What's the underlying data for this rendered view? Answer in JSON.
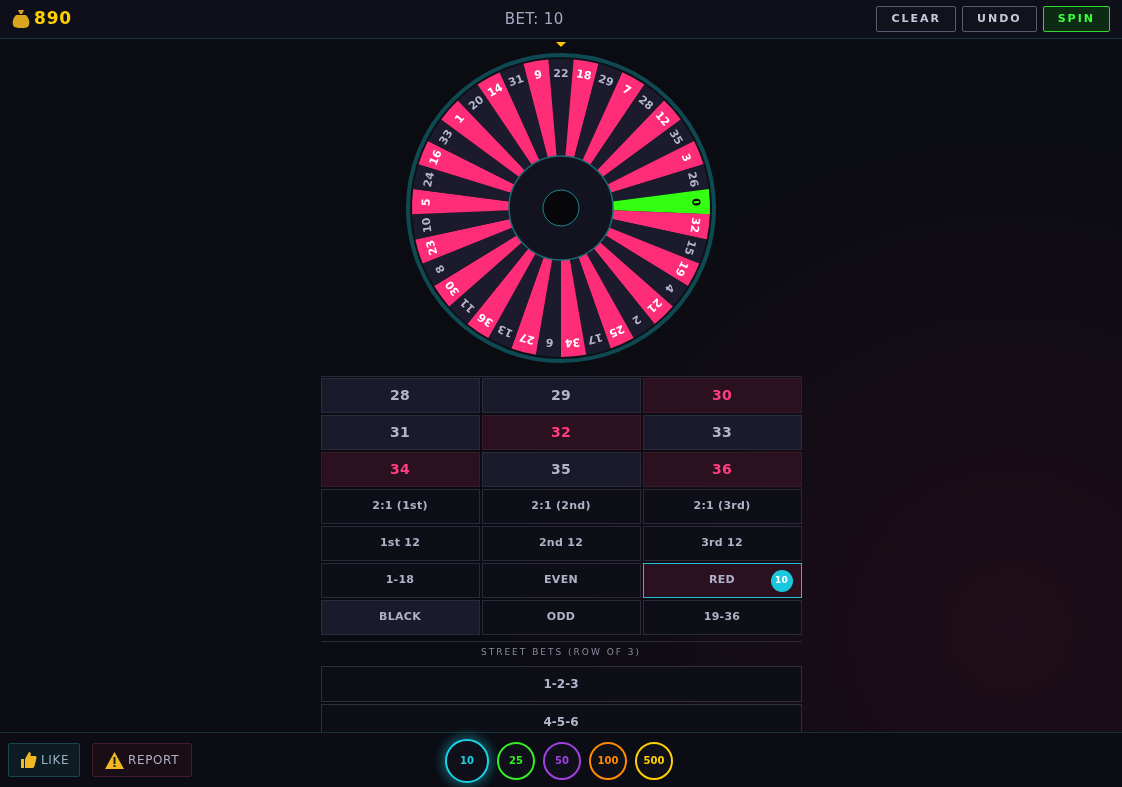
{
  "header": {
    "balance": "890",
    "bet": "BET: 10",
    "buttons": [
      {
        "label": "CLEAR",
        "kind": "plain"
      },
      {
        "label": "UNDO",
        "kind": "plain"
      },
      {
        "label": "SPIN",
        "kind": "primary"
      }
    ]
  },
  "wheel": {
    "pockets": [
      {
        "number": "22",
        "color": "#1c1b2e"
      },
      {
        "number": "18",
        "color": "#ff2d78"
      },
      {
        "number": "29",
        "color": "#1c1b2e"
      },
      {
        "number": "7",
        "color": "#ff2d78"
      },
      {
        "number": "28",
        "color": "#1c1b2e"
      },
      {
        "number": "12",
        "color": "#ff2d78"
      },
      {
        "number": "35",
        "color": "#1c1b2e"
      },
      {
        "number": "3",
        "color": "#ff2d78"
      },
      {
        "number": "26",
        "color": "#1c1b2e"
      },
      {
        "number": "0",
        "color": "#33ff11"
      },
      {
        "number": "32",
        "color": "#ff2d78"
      },
      {
        "number": "15",
        "color": "#1c1b2e"
      },
      {
        "number": "19",
        "color": "#ff2d78"
      },
      {
        "number": "4",
        "color": "#1c1b2e"
      },
      {
        "number": "21",
        "color": "#ff2d78"
      },
      {
        "number": "2",
        "color": "#1c1b2e"
      },
      {
        "number": "25",
        "color": "#ff2d78"
      },
      {
        "number": "17",
        "color": "#1c1b2e"
      },
      {
        "number": "34",
        "color": "#ff2d78"
      },
      {
        "number": "6",
        "color": "#1c1b2e"
      },
      {
        "number": "27",
        "color": "#ff2d78"
      },
      {
        "number": "13",
        "color": "#1c1b2e"
      },
      {
        "number": "36",
        "color": "#ff2d78"
      },
      {
        "number": "11",
        "color": "#1c1b2e"
      },
      {
        "number": "30",
        "color": "#ff2d78"
      },
      {
        "number": "8",
        "color": "#1c1b2e"
      },
      {
        "number": "23",
        "color": "#ff2d78"
      },
      {
        "number": "10",
        "color": "#1c1b2e"
      },
      {
        "number": "5",
        "color": "#ff2d78"
      },
      {
        "number": "24",
        "color": "#1c1b2e"
      },
      {
        "number": "16",
        "color": "#ff2d78"
      },
      {
        "number": "33",
        "color": "#1c1b2e"
      },
      {
        "number": "1",
        "color": "#ff2d78"
      },
      {
        "number": "20",
        "color": "#1c1b2e"
      },
      {
        "number": "14",
        "color": "#ff2d78"
      },
      {
        "number": "31",
        "color": "#1c1b2e"
      },
      {
        "number": "9",
        "color": "#ff2d78"
      }
    ]
  },
  "board": {
    "rows": [
      {
        "cells": [
          {
            "label": "28",
            "kind": "black",
            "selected": false
          },
          {
            "label": "29",
            "kind": "black",
            "selected": false
          },
          {
            "label": "30",
            "kind": "red",
            "selected": false
          }
        ]
      },
      {
        "cells": [
          {
            "label": "31",
            "kind": "black",
            "selected": false
          },
          {
            "label": "32",
            "kind": "red",
            "selected": false
          },
          {
            "label": "33",
            "kind": "black",
            "selected": false
          }
        ]
      },
      {
        "cells": [
          {
            "label": "34",
            "kind": "red",
            "selected": false
          },
          {
            "label": "35",
            "kind": "black",
            "selected": false
          },
          {
            "label": "36",
            "kind": "red",
            "selected": false
          }
        ]
      },
      {
        "cells": [
          {
            "label": "2:1 (1st)",
            "kind": "outside",
            "selected": false
          },
          {
            "label": "2:1 (2nd)",
            "kind": "outside",
            "selected": false
          },
          {
            "label": "2:1 (3rd)",
            "kind": "outside",
            "selected": false
          }
        ]
      },
      {
        "cells": [
          {
            "label": "1st 12",
            "kind": "outside",
            "selected": false
          },
          {
            "label": "2nd 12",
            "kind": "outside",
            "selected": false
          },
          {
            "label": "3rd 12",
            "kind": "outside",
            "selected": false
          }
        ]
      },
      {
        "cells": [
          {
            "label": "1-18",
            "kind": "outside",
            "selected": false
          },
          {
            "label": "EVEN",
            "kind": "outside",
            "selected": false
          },
          {
            "label": "RED",
            "kind": "redbet",
            "selected": true,
            "chip": "10"
          }
        ]
      },
      {
        "cells": [
          {
            "label": "BLACK",
            "kind": "blackbet",
            "selected": false
          },
          {
            "label": "ODD",
            "kind": "outside",
            "selected": false
          },
          {
            "label": "19-36",
            "kind": "outside",
            "selected": false
          }
        ]
      }
    ]
  },
  "street_bets": {
    "title": "STREET BETS (ROW OF 3)",
    "rows": [
      "1-2-3",
      "4-5-6"
    ]
  },
  "footer": {
    "like": "LIKE",
    "report": "REPORT",
    "chips": [
      {
        "value": "10",
        "color": "#19d3e6",
        "selected": true
      },
      {
        "value": "25",
        "color": "#33ee22",
        "selected": false
      },
      {
        "value": "50",
        "color": "#a040e0",
        "selected": false
      },
      {
        "value": "100",
        "color": "#ff8a00",
        "selected": false
      },
      {
        "value": "500",
        "color": "#ffd000",
        "selected": false
      }
    ]
  }
}
